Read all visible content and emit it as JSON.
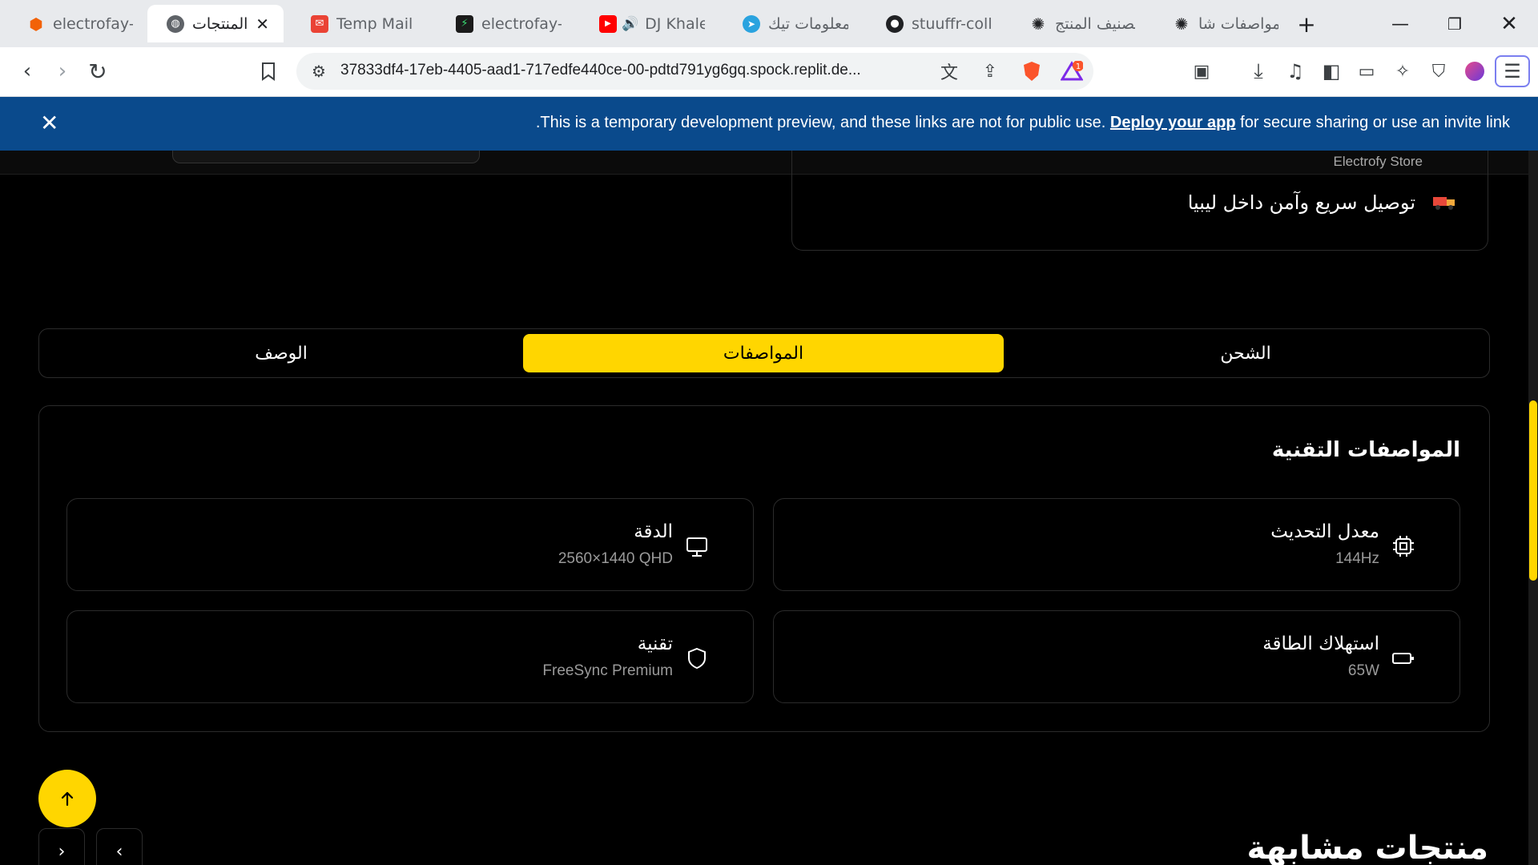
{
  "browser": {
    "tabs": [
      {
        "title": "electrofay-st",
        "active": false
      },
      {
        "title": "المنتجات",
        "active": true
      },
      {
        "title": "Temp Mail - T",
        "active": false
      },
      {
        "title": "electrofay-st",
        "active": false
      },
      {
        "title": "DJ Khale",
        "active": false
      },
      {
        "title": "معلومات تيك",
        "active": false
      },
      {
        "title": "stuuffr-collab",
        "active": false
      },
      {
        "title": "تصنيف المنتج",
        "active": false
      },
      {
        "title": "مواصفات شا",
        "active": false
      }
    ],
    "close_glyph": "✕",
    "new_tab_glyph": "+",
    "url": "37833df4-17eb-4405-aad1-717edfe440ce-00-pdtd791yg6gq.spock.replit.de...",
    "brave_badge": "1",
    "brand_color": "#fb542b"
  },
  "banner": {
    "message_before": ".This is a temporary development preview, and these links are not for public use.",
    "link_text": "Deploy your app",
    "message_after": "for secure sharing or use an invite link",
    "background_color": "#0a4a8c"
  },
  "page": {
    "store_name": "Electrofy Store",
    "delivery_text": "توصيل سريع وآمن داخل ليبيا",
    "tabs": [
      {
        "label": "الشحن",
        "active": false
      },
      {
        "label": "المواصفات",
        "active": true
      },
      {
        "label": "الوصف",
        "active": false
      }
    ],
    "accent_color": "#ffd600",
    "specs_title": "المواصفات التقنية",
    "specs": [
      {
        "label": "معدل التحديث",
        "value": "144Hz",
        "icon": "cpu-icon"
      },
      {
        "label": "الدقة",
        "value": "2560×1440 QHD",
        "icon": "monitor-icon"
      },
      {
        "label": "استهلاك الطاقة",
        "value": "65W",
        "icon": "battery-icon"
      },
      {
        "label": "تقنية",
        "value": "FreeSync Premium",
        "icon": "shield-icon"
      }
    ],
    "similar_title": "منتجات مشابهة"
  }
}
